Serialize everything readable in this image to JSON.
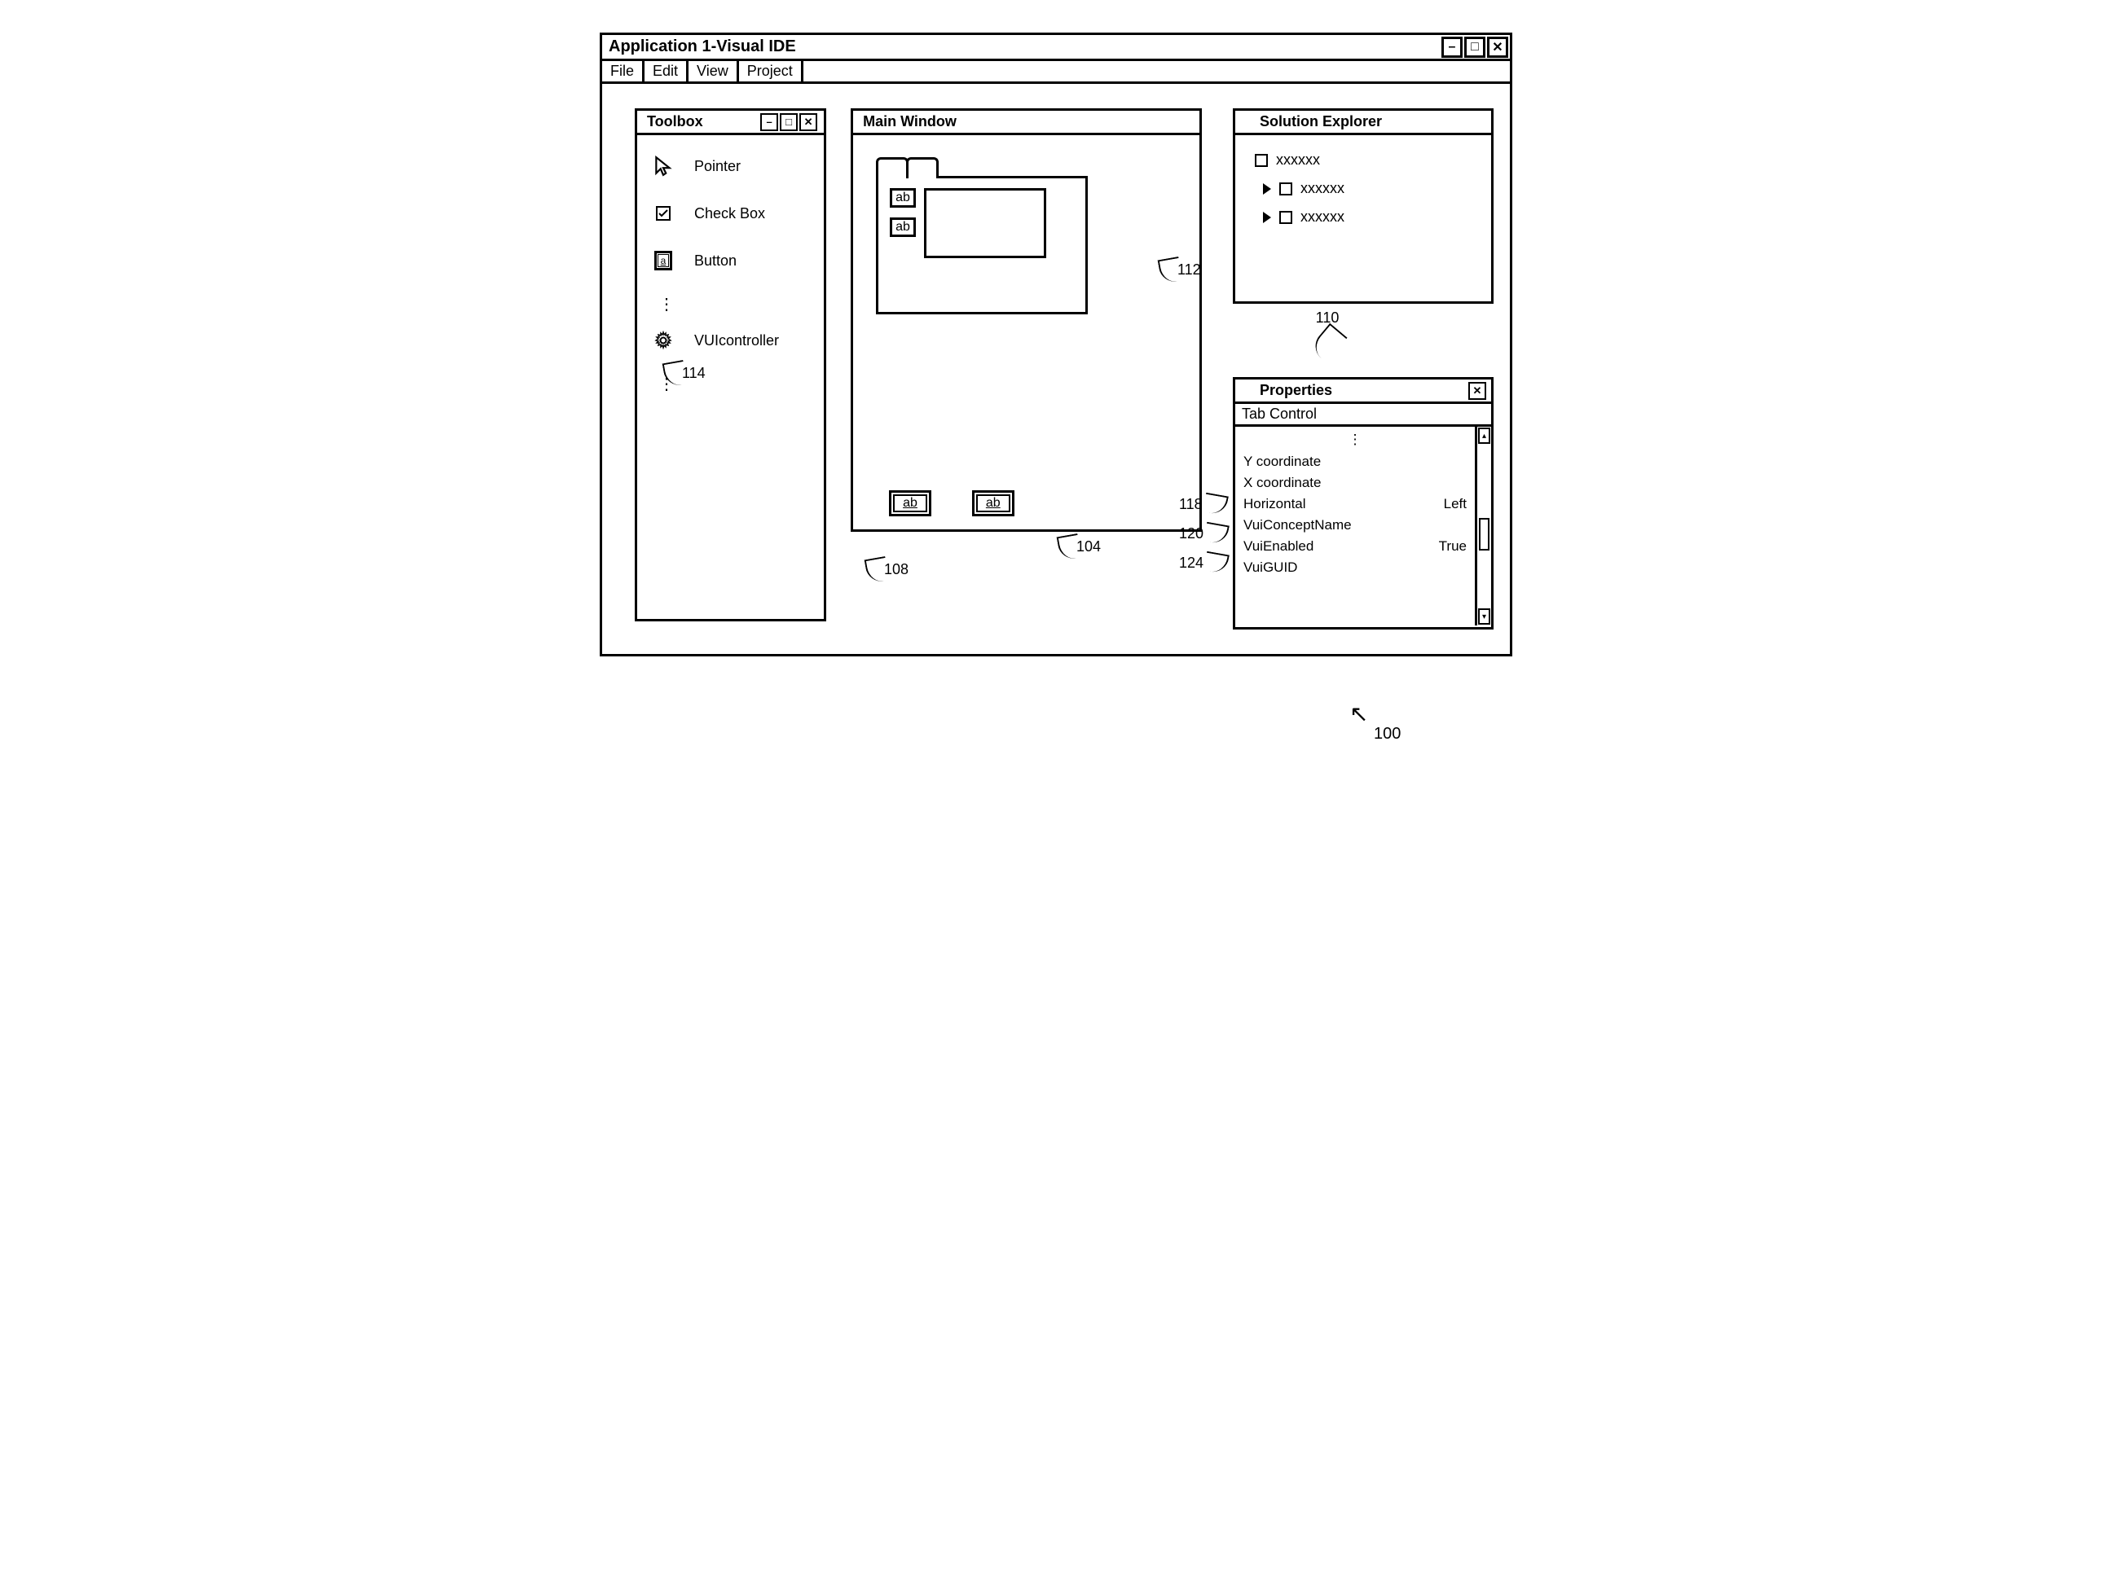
{
  "window": {
    "title": "Application 1-Visual IDE"
  },
  "menu": [
    "File",
    "Edit",
    "View",
    "Project"
  ],
  "toolbox": {
    "title": "Toolbox",
    "items": [
      {
        "label": "Pointer"
      },
      {
        "label": "Check Box"
      },
      {
        "label": "Button"
      },
      {
        "label": "VUIcontroller"
      }
    ]
  },
  "main": {
    "title": "Main Window",
    "ab": "ab"
  },
  "solution": {
    "title": "Solution Explorer",
    "item": "xxxxxx"
  },
  "properties": {
    "title": "Properties",
    "subtitle": "Tab Control",
    "rows": [
      {
        "name": "Y coordinate",
        "value": ""
      },
      {
        "name": "X coordinate",
        "value": ""
      },
      {
        "name": "Horizontal",
        "value": "Left"
      },
      {
        "name": "VuiConceptName",
        "value": ""
      },
      {
        "name": "VuiEnabled",
        "value": "True"
      },
      {
        "name": "VuiGUID",
        "value": ""
      }
    ]
  },
  "refs": {
    "r100": "100",
    "r104": "104",
    "r108": "108",
    "r110": "110",
    "r112": "112",
    "r114": "114",
    "r118": "118",
    "r120": "120",
    "r124": "124"
  }
}
